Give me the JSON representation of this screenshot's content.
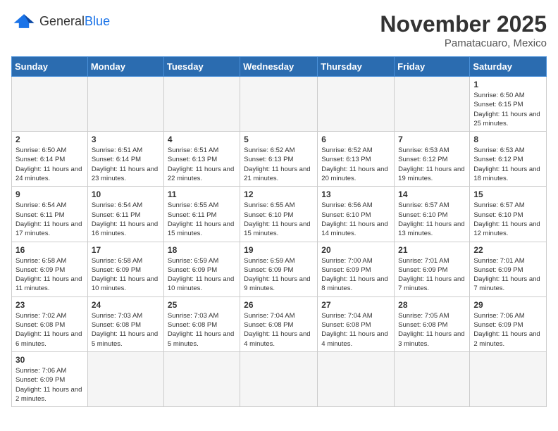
{
  "header": {
    "logo_general": "General",
    "logo_blue": "Blue",
    "title": "November 2025",
    "subtitle": "Pamatacuaro, Mexico"
  },
  "days_of_week": [
    "Sunday",
    "Monday",
    "Tuesday",
    "Wednesday",
    "Thursday",
    "Friday",
    "Saturday"
  ],
  "weeks": [
    [
      {
        "day": "",
        "empty": true
      },
      {
        "day": "",
        "empty": true
      },
      {
        "day": "",
        "empty": true
      },
      {
        "day": "",
        "empty": true
      },
      {
        "day": "",
        "empty": true
      },
      {
        "day": "",
        "empty": true
      },
      {
        "day": "1",
        "sunrise": "6:50 AM",
        "sunset": "6:15 PM",
        "daylight": "11 hours and 25 minutes."
      }
    ],
    [
      {
        "day": "2",
        "sunrise": "6:50 AM",
        "sunset": "6:14 PM",
        "daylight": "11 hours and 24 minutes."
      },
      {
        "day": "3",
        "sunrise": "6:51 AM",
        "sunset": "6:14 PM",
        "daylight": "11 hours and 23 minutes."
      },
      {
        "day": "4",
        "sunrise": "6:51 AM",
        "sunset": "6:13 PM",
        "daylight": "11 hours and 22 minutes."
      },
      {
        "day": "5",
        "sunrise": "6:52 AM",
        "sunset": "6:13 PM",
        "daylight": "11 hours and 21 minutes."
      },
      {
        "day": "6",
        "sunrise": "6:52 AM",
        "sunset": "6:13 PM",
        "daylight": "11 hours and 20 minutes."
      },
      {
        "day": "7",
        "sunrise": "6:53 AM",
        "sunset": "6:12 PM",
        "daylight": "11 hours and 19 minutes."
      },
      {
        "day": "8",
        "sunrise": "6:53 AM",
        "sunset": "6:12 PM",
        "daylight": "11 hours and 18 minutes."
      }
    ],
    [
      {
        "day": "9",
        "sunrise": "6:54 AM",
        "sunset": "6:11 PM",
        "daylight": "11 hours and 17 minutes."
      },
      {
        "day": "10",
        "sunrise": "6:54 AM",
        "sunset": "6:11 PM",
        "daylight": "11 hours and 16 minutes."
      },
      {
        "day": "11",
        "sunrise": "6:55 AM",
        "sunset": "6:11 PM",
        "daylight": "11 hours and 15 minutes."
      },
      {
        "day": "12",
        "sunrise": "6:55 AM",
        "sunset": "6:10 PM",
        "daylight": "11 hours and 15 minutes."
      },
      {
        "day": "13",
        "sunrise": "6:56 AM",
        "sunset": "6:10 PM",
        "daylight": "11 hours and 14 minutes."
      },
      {
        "day": "14",
        "sunrise": "6:57 AM",
        "sunset": "6:10 PM",
        "daylight": "11 hours and 13 minutes."
      },
      {
        "day": "15",
        "sunrise": "6:57 AM",
        "sunset": "6:10 PM",
        "daylight": "11 hours and 12 minutes."
      }
    ],
    [
      {
        "day": "16",
        "sunrise": "6:58 AM",
        "sunset": "6:09 PM",
        "daylight": "11 hours and 11 minutes."
      },
      {
        "day": "17",
        "sunrise": "6:58 AM",
        "sunset": "6:09 PM",
        "daylight": "11 hours and 10 minutes."
      },
      {
        "day": "18",
        "sunrise": "6:59 AM",
        "sunset": "6:09 PM",
        "daylight": "11 hours and 10 minutes."
      },
      {
        "day": "19",
        "sunrise": "6:59 AM",
        "sunset": "6:09 PM",
        "daylight": "11 hours and 9 minutes."
      },
      {
        "day": "20",
        "sunrise": "7:00 AM",
        "sunset": "6:09 PM",
        "daylight": "11 hours and 8 minutes."
      },
      {
        "day": "21",
        "sunrise": "7:01 AM",
        "sunset": "6:09 PM",
        "daylight": "11 hours and 7 minutes."
      },
      {
        "day": "22",
        "sunrise": "7:01 AM",
        "sunset": "6:09 PM",
        "daylight": "11 hours and 7 minutes."
      }
    ],
    [
      {
        "day": "23",
        "sunrise": "7:02 AM",
        "sunset": "6:08 PM",
        "daylight": "11 hours and 6 minutes."
      },
      {
        "day": "24",
        "sunrise": "7:03 AM",
        "sunset": "6:08 PM",
        "daylight": "11 hours and 5 minutes."
      },
      {
        "day": "25",
        "sunrise": "7:03 AM",
        "sunset": "6:08 PM",
        "daylight": "11 hours and 5 minutes."
      },
      {
        "day": "26",
        "sunrise": "7:04 AM",
        "sunset": "6:08 PM",
        "daylight": "11 hours and 4 minutes."
      },
      {
        "day": "27",
        "sunrise": "7:04 AM",
        "sunset": "6:08 PM",
        "daylight": "11 hours and 4 minutes."
      },
      {
        "day": "28",
        "sunrise": "7:05 AM",
        "sunset": "6:08 PM",
        "daylight": "11 hours and 3 minutes."
      },
      {
        "day": "29",
        "sunrise": "7:06 AM",
        "sunset": "6:09 PM",
        "daylight": "11 hours and 2 minutes."
      }
    ],
    [
      {
        "day": "30",
        "sunrise": "7:06 AM",
        "sunset": "6:09 PM",
        "daylight": "11 hours and 2 minutes."
      },
      {
        "day": "",
        "empty": true
      },
      {
        "day": "",
        "empty": true
      },
      {
        "day": "",
        "empty": true
      },
      {
        "day": "",
        "empty": true
      },
      {
        "day": "",
        "empty": true
      },
      {
        "day": "",
        "empty": true
      }
    ]
  ]
}
